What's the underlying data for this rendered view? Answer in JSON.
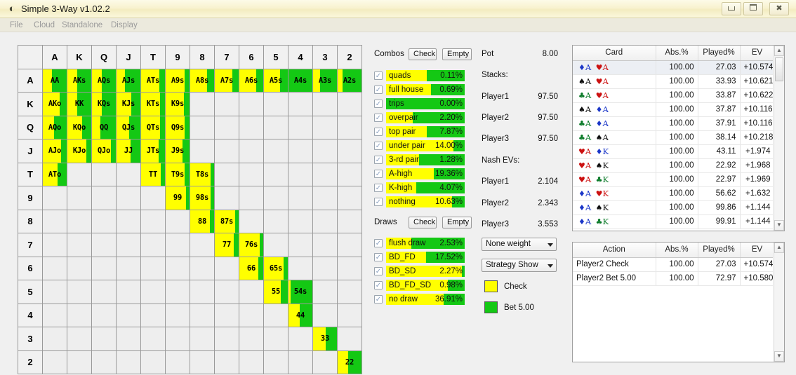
{
  "window": {
    "title": "Simple 3-Way v1.02.2",
    "icon": "app-icon",
    "minimize_label": "minimize",
    "maximize_label": "maximize",
    "close_label": "✖"
  },
  "menu": {
    "items": [
      "File",
      "Cloud",
      "Standalone",
      "Display"
    ]
  },
  "matrix": {
    "ranks": [
      "A",
      "K",
      "Q",
      "J",
      "T",
      "9",
      "8",
      "7",
      "6",
      "5",
      "4",
      "3",
      "2"
    ],
    "cells": [
      [
        {
          "l": "AA",
          "y": 38
        },
        {
          "l": "AKs",
          "y": 40
        },
        {
          "l": "AQs",
          "y": 42
        },
        {
          "l": "AJs",
          "y": 36
        },
        {
          "l": "ATs",
          "y": 76
        },
        {
          "l": "A9s",
          "y": 78
        },
        {
          "l": "A8s",
          "y": 72
        },
        {
          "l": "A7s",
          "y": 74
        },
        {
          "l": "A6s",
          "y": 72
        },
        {
          "l": "A5s",
          "y": 68
        },
        {
          "l": "A4s",
          "y": 0
        },
        {
          "l": "A3s",
          "y": 30
        },
        {
          "l": "A2s",
          "y": 22
        }
      ],
      [
        {
          "l": "AKo",
          "y": 72
        },
        {
          "l": "KK",
          "y": 40
        },
        {
          "l": "KQs",
          "y": 40
        },
        {
          "l": "KJs",
          "y": 62
        },
        {
          "l": "KTs",
          "y": 80
        },
        {
          "l": "K9s",
          "y": 76
        },
        null,
        null,
        null,
        null,
        null,
        null,
        null
      ],
      [
        {
          "l": "AQo",
          "y": 48
        },
        {
          "l": "KQo",
          "y": 62
        },
        {
          "l": "QQ",
          "y": 36
        },
        {
          "l": "QJs",
          "y": 52
        },
        {
          "l": "QTs",
          "y": 78
        },
        {
          "l": "Q9s",
          "y": 78
        },
        null,
        null,
        null,
        null,
        null,
        null,
        null
      ],
      [
        {
          "l": "AJo",
          "y": 76
        },
        {
          "l": "KJo",
          "y": 78
        },
        {
          "l": "QJo",
          "y": 80
        },
        {
          "l": "JJ",
          "y": 60
        },
        {
          "l": "JTs",
          "y": 74
        },
        {
          "l": "J9s",
          "y": 70
        },
        null,
        null,
        null,
        null,
        null,
        null,
        null
      ],
      [
        {
          "l": "ATo",
          "y": 62
        },
        null,
        null,
        null,
        {
          "l": "TT",
          "y": 82
        },
        {
          "l": "T9s",
          "y": 80
        },
        {
          "l": "T8s",
          "y": 86
        },
        null,
        null,
        null,
        null,
        null,
        null
      ],
      [
        null,
        null,
        null,
        null,
        null,
        {
          "l": "99",
          "y": 84
        },
        {
          "l": "98s",
          "y": 86
        },
        null,
        null,
        null,
        null,
        null,
        null
      ],
      [
        null,
        null,
        null,
        null,
        null,
        null,
        {
          "l": "88",
          "y": 82
        },
        {
          "l": "87s",
          "y": 86
        },
        null,
        null,
        null,
        null,
        null
      ],
      [
        null,
        null,
        null,
        null,
        null,
        null,
        null,
        {
          "l": "77",
          "y": 80
        },
        {
          "l": "76s",
          "y": 86
        },
        null,
        null,
        null,
        null
      ],
      [
        null,
        null,
        null,
        null,
        null,
        null,
        null,
        null,
        {
          "l": "66",
          "y": 78
        },
        {
          "l": "65s",
          "y": 82
        },
        null,
        null,
        null
      ],
      [
        null,
        null,
        null,
        null,
        null,
        null,
        null,
        null,
        null,
        {
          "l": "55",
          "y": 72
        },
        {
          "l": "54s",
          "y": 8
        },
        null,
        null
      ],
      [
        null,
        null,
        null,
        null,
        null,
        null,
        null,
        null,
        null,
        null,
        {
          "l": "44",
          "y": 48
        },
        null,
        null
      ],
      [
        null,
        null,
        null,
        null,
        null,
        null,
        null,
        null,
        null,
        null,
        null,
        {
          "l": "33",
          "y": 52
        },
        null
      ],
      [
        null,
        null,
        null,
        null,
        null,
        null,
        null,
        null,
        null,
        null,
        null,
        null,
        {
          "l": "22",
          "y": 44
        }
      ]
    ]
  },
  "combos": {
    "title": "Combos",
    "check_label": "Check",
    "empty_label": "Empty",
    "rows": [
      {
        "name": "quads",
        "value": "0.11%",
        "yellow_pct": 52
      },
      {
        "name": "full house",
        "value": "0.69%",
        "yellow_pct": 57
      },
      {
        "name": "trips",
        "value": "0.00%",
        "yellow_pct": 0
      },
      {
        "name": "overpair",
        "value": "2.20%",
        "yellow_pct": 34
      },
      {
        "name": "top pair",
        "value": "7.87%",
        "yellow_pct": 52
      },
      {
        "name": "under pair",
        "value": "14.00%",
        "yellow_pct": 86
      },
      {
        "name": "3-rd pair",
        "value": "1.28%",
        "yellow_pct": 42
      },
      {
        "name": "A-high",
        "value": "19.36%",
        "yellow_pct": 61
      },
      {
        "name": "K-high",
        "value": "4.07%",
        "yellow_pct": 38
      },
      {
        "name": "nothing",
        "value": "10.63%",
        "yellow_pct": 84
      }
    ]
  },
  "draws": {
    "title": "Draws",
    "check_label": "Check",
    "empty_label": "Empty",
    "rows": [
      {
        "name": "flush draw",
        "value": "2.53%",
        "yellow_pct": 32
      },
      {
        "name": "BD_FD",
        "value": "17.52%",
        "yellow_pct": 51
      },
      {
        "name": "BD_SD",
        "value": "2.27%",
        "yellow_pct": 96
      },
      {
        "name": "BD_FD_SD",
        "value": "0.98%",
        "yellow_pct": 79
      },
      {
        "name": "no draw",
        "value": "36.91%",
        "yellow_pct": 73
      }
    ]
  },
  "game_info": {
    "pot_label": "Pot",
    "pot_value": "8.00",
    "stacks_label": "Stacks:",
    "stacks": [
      {
        "label": "Player1",
        "value": "97.50"
      },
      {
        "label": "Player2",
        "value": "97.50"
      },
      {
        "label": "Player3",
        "value": "97.50"
      }
    ],
    "nash_label": "Nash EVs:",
    "nash": [
      {
        "label": "Player1",
        "value": "2.104"
      },
      {
        "label": "Player2",
        "value": "2.343"
      },
      {
        "label": "Player3",
        "value": "3.553"
      }
    ],
    "weight_select": "None weight",
    "strategy_select": "Strategy Show"
  },
  "legend": {
    "items": [
      {
        "label": "Check",
        "color": "#ffff00"
      },
      {
        "label": "Bet 5.00",
        "color": "#14c814"
      }
    ]
  },
  "card_table": {
    "headers": [
      "Card",
      "Abs.%",
      "Played%",
      "EV"
    ],
    "rows": [
      {
        "cards": [
          {
            "suit": "d",
            "rank": "A"
          },
          {
            "suit": "h",
            "rank": "A"
          }
        ],
        "abs": "100.00",
        "played": "27.03",
        "ev": "+10.574",
        "selected": true
      },
      {
        "cards": [
          {
            "suit": "s",
            "rank": "A"
          },
          {
            "suit": "h",
            "rank": "A"
          }
        ],
        "abs": "100.00",
        "played": "33.93",
        "ev": "+10.621"
      },
      {
        "cards": [
          {
            "suit": "c",
            "rank": "A"
          },
          {
            "suit": "h",
            "rank": "A"
          }
        ],
        "abs": "100.00",
        "played": "33.87",
        "ev": "+10.622"
      },
      {
        "cards": [
          {
            "suit": "s",
            "rank": "A"
          },
          {
            "suit": "d",
            "rank": "A"
          }
        ],
        "abs": "100.00",
        "played": "37.87",
        "ev": "+10.116"
      },
      {
        "cards": [
          {
            "suit": "c",
            "rank": "A"
          },
          {
            "suit": "d",
            "rank": "A"
          }
        ],
        "abs": "100.00",
        "played": "37.91",
        "ev": "+10.116"
      },
      {
        "cards": [
          {
            "suit": "c",
            "rank": "A"
          },
          {
            "suit": "s",
            "rank": "A"
          }
        ],
        "abs": "100.00",
        "played": "38.14",
        "ev": "+10.218"
      },
      {
        "cards": [
          {
            "suit": "h",
            "rank": "A"
          },
          {
            "suit": "d",
            "rank": "K"
          }
        ],
        "abs": "100.00",
        "played": "43.11",
        "ev": "+1.974"
      },
      {
        "cards": [
          {
            "suit": "h",
            "rank": "A"
          },
          {
            "suit": "s",
            "rank": "K"
          }
        ],
        "abs": "100.00",
        "played": "22.92",
        "ev": "+1.968"
      },
      {
        "cards": [
          {
            "suit": "h",
            "rank": "A"
          },
          {
            "suit": "c",
            "rank": "K"
          }
        ],
        "abs": "100.00",
        "played": "22.97",
        "ev": "+1.969"
      },
      {
        "cards": [
          {
            "suit": "d",
            "rank": "A"
          },
          {
            "suit": "h",
            "rank": "K"
          }
        ],
        "abs": "100.00",
        "played": "56.62",
        "ev": "+1.632"
      },
      {
        "cards": [
          {
            "suit": "d",
            "rank": "A"
          },
          {
            "suit": "s",
            "rank": "K"
          }
        ],
        "abs": "100.00",
        "played": "99.86",
        "ev": "+1.144"
      },
      {
        "cards": [
          {
            "suit": "d",
            "rank": "A"
          },
          {
            "suit": "c",
            "rank": "K"
          }
        ],
        "abs": "100.00",
        "played": "99.91",
        "ev": "+1.144"
      }
    ]
  },
  "action_table": {
    "headers": [
      "Action",
      "Abs.%",
      "Played%",
      "EV"
    ],
    "rows": [
      {
        "action": "Player2 Check",
        "abs": "100.00",
        "played": "27.03",
        "ev": "+10.574"
      },
      {
        "action": "Player2 Bet 5.00",
        "abs": "100.00",
        "played": "72.97",
        "ev": "+10.580"
      }
    ]
  }
}
